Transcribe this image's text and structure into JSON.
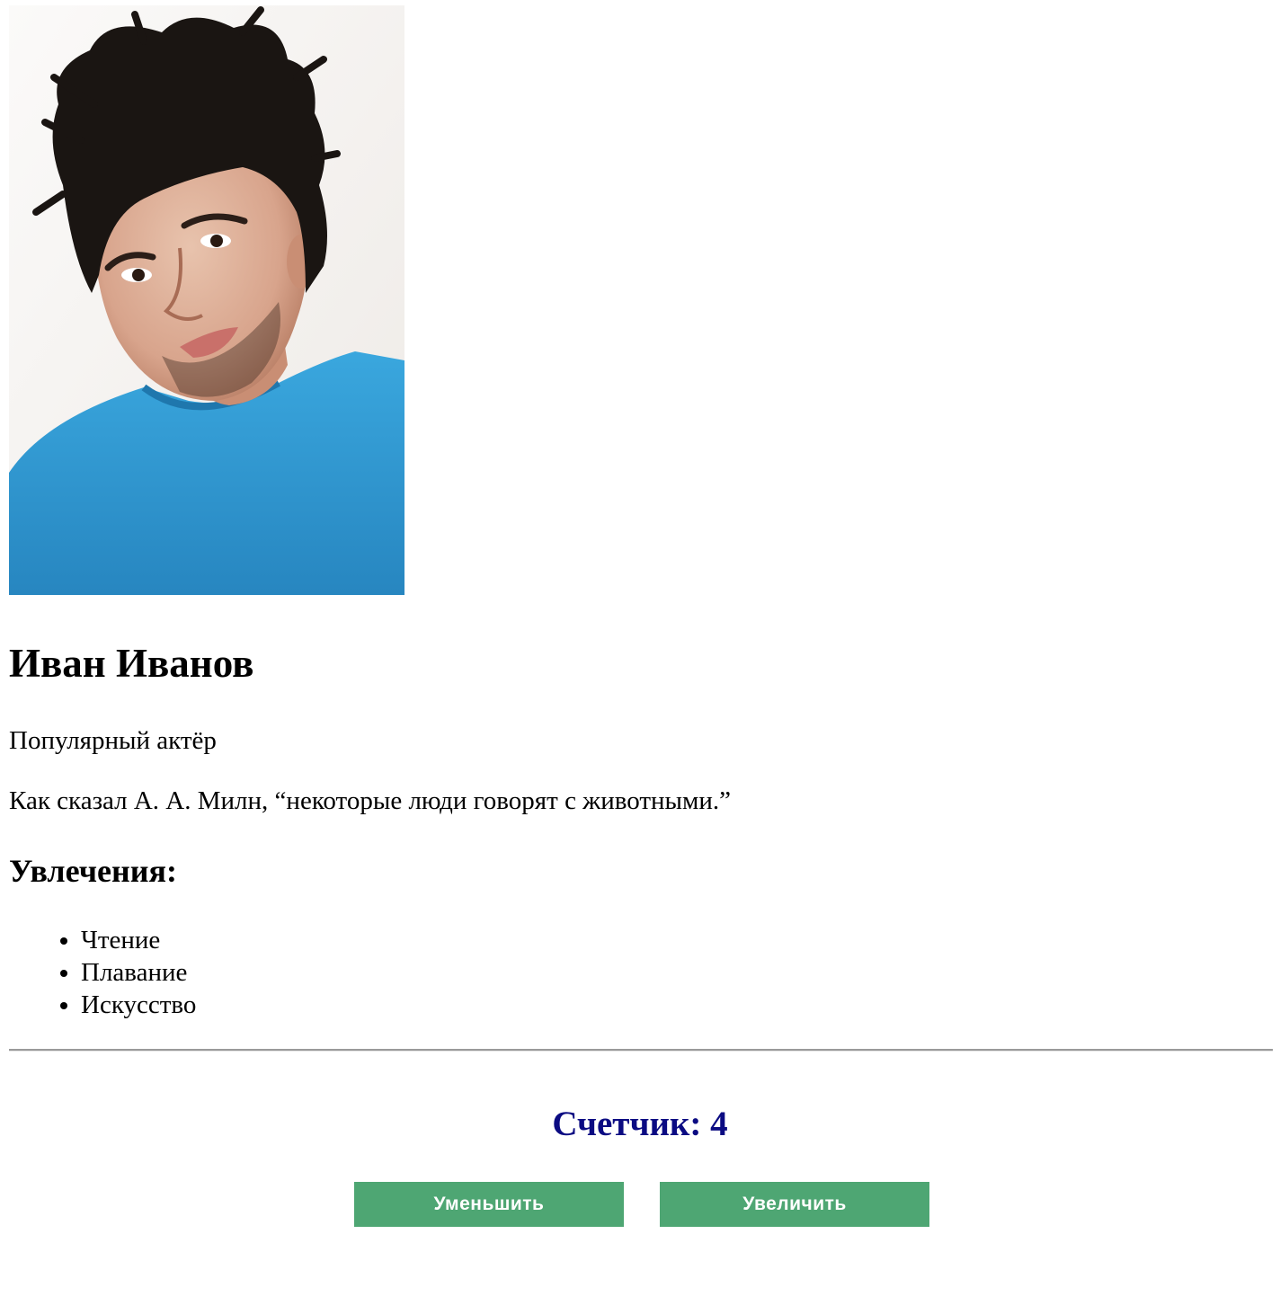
{
  "profile": {
    "name": "Иван Иванов",
    "subtitle": "Популярный актёр",
    "quote": "Как сказал А. А. Милн, “некоторые люди говорят с животными.”",
    "photo_alt": "Портрет"
  },
  "hobbies": {
    "heading": "Увлечения:",
    "items": [
      "Чтение",
      "Плавание",
      "Искусство"
    ]
  },
  "counter": {
    "label": "Счетчик: 4",
    "value": 4,
    "decrement_label": "Уменьшить",
    "increment_label": "Увеличить"
  },
  "colors": {
    "counter_text": "#0b0b82",
    "button_bg": "#4ea673",
    "shirt": "#2a95cc",
    "hair": "#1a1512"
  }
}
